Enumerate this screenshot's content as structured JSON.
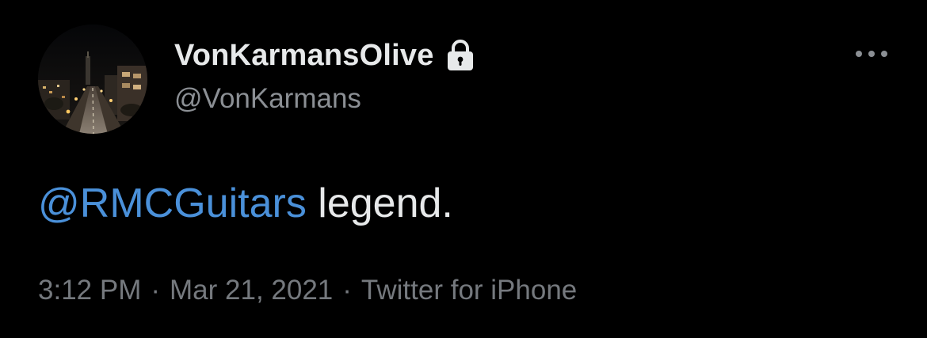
{
  "author": {
    "display_name": "VonKarmansOlive",
    "handle": "@VonKarmans",
    "avatar_icon": "night-street-photo",
    "protected_icon": "lock-icon"
  },
  "tweet": {
    "mention": "@RMCGuitars",
    "text": " legend."
  },
  "meta": {
    "time": "3:12 PM",
    "separator": "·",
    "date": "Mar 21, 2021",
    "source": "Twitter for iPhone"
  },
  "actions": {
    "more_icon": "more-horizontal-icon"
  },
  "colors": {
    "background": "#000000",
    "primary_text": "#e7e9ea",
    "secondary_text": "#8b8f94",
    "meta_text": "#75797e",
    "mention": "#4a90d9"
  }
}
